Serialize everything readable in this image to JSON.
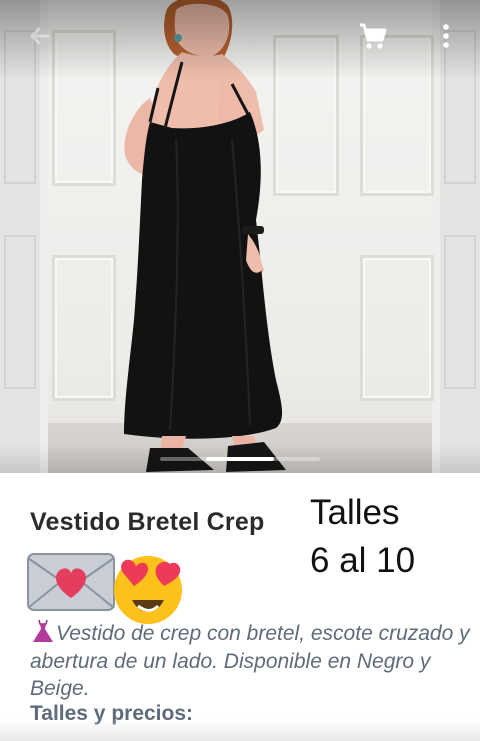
{
  "product": {
    "title": "Vestido Bretel Crep",
    "description": "Vestido de crep con bretel, escote cruzado y abertura de un lado. Disponible en Negro y Beige.",
    "prices_heading": "Talles y precios:"
  },
  "sizes_callout": {
    "line1": "Talles",
    "line2": "6 al 10"
  },
  "toolbar": {
    "back_icon": "arrow-left-icon",
    "cart_icon": "shopping-cart-icon",
    "menu_icon": "more-vertical-icon"
  },
  "emojis": [
    "love-letter-emoji",
    "heart-eyes-emoji",
    "dress-emoji"
  ],
  "gallery": {
    "image": "model in long black strappy crepe dress",
    "dress_color": "#111111"
  },
  "colors": {
    "title_text": "#2b2b2b",
    "description_text": "#5f6b7a",
    "sizes_text": "#111111"
  }
}
